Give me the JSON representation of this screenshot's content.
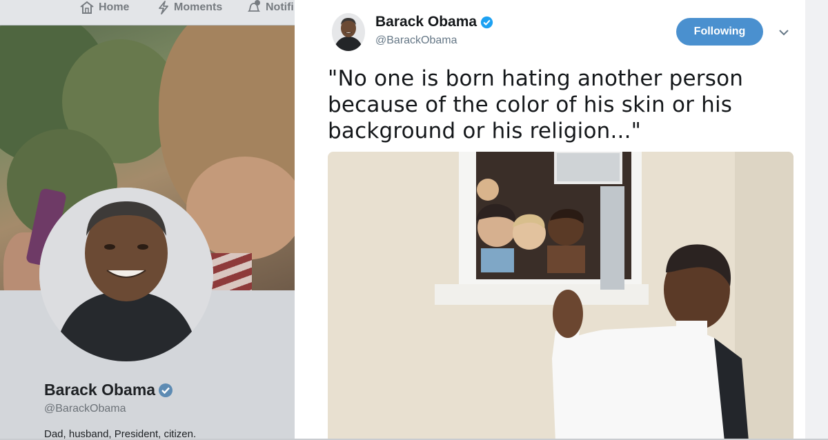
{
  "nav": {
    "home_label": "Home",
    "moments_label": "Moments",
    "notifications_label": "Notifi"
  },
  "profile": {
    "name": "Barack Obama",
    "handle": "@BarackObama",
    "bio": "Dad, husband, President, citizen."
  },
  "tweet": {
    "author_name": "Barack Obama",
    "author_handle": "@BarackObama",
    "follow_label": "Following",
    "text_lines": [
      "\"No one is born hating another person",
      "because of the color of his skin or his",
      "background or his religion...\""
    ]
  },
  "colors": {
    "accent": "#4a90cf",
    "verified": "#1da1f2",
    "text": "#14171a",
    "secondary_text": "#657786"
  },
  "icons": [
    "home-icon",
    "moments-icon",
    "notifications-icon",
    "verified-badge-icon",
    "chevron-down-icon"
  ]
}
